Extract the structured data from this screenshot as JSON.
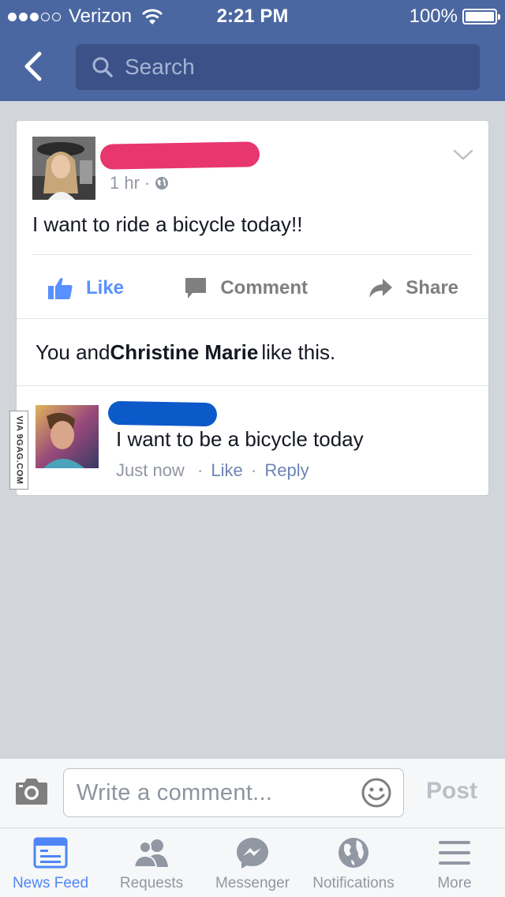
{
  "status_bar": {
    "carrier": "Verizon",
    "time": "2:21 PM",
    "battery": "100%"
  },
  "header": {
    "search_placeholder": "Search"
  },
  "post": {
    "time": "1 hr",
    "meta_separator": "·",
    "text": "I want to ride a bicycle today!!",
    "actions": {
      "like": "Like",
      "comment": "Comment",
      "share": "Share"
    },
    "likes": {
      "prefix": "You and",
      "name": "Christine Marie",
      "suffix": "like this."
    }
  },
  "comment": {
    "text": "I want to be a bicycle today",
    "time": "Just now",
    "separator": "·",
    "like": "Like",
    "reply": "Reply"
  },
  "watermark": "VIA 9GAG.COM",
  "composer": {
    "placeholder": "Write a comment...",
    "post_label": "Post"
  },
  "tabs": [
    {
      "label": "News Feed",
      "active": true
    },
    {
      "label": "Requests",
      "active": false
    },
    {
      "label": "Messenger",
      "active": false
    },
    {
      "label": "Notifications",
      "active": false
    },
    {
      "label": "More",
      "active": false
    }
  ],
  "colors": {
    "header": "#4b67a1",
    "like_blue": "#5890ff",
    "redaction_pink": "#e8366f",
    "redaction_blue": "#0c59c9"
  }
}
